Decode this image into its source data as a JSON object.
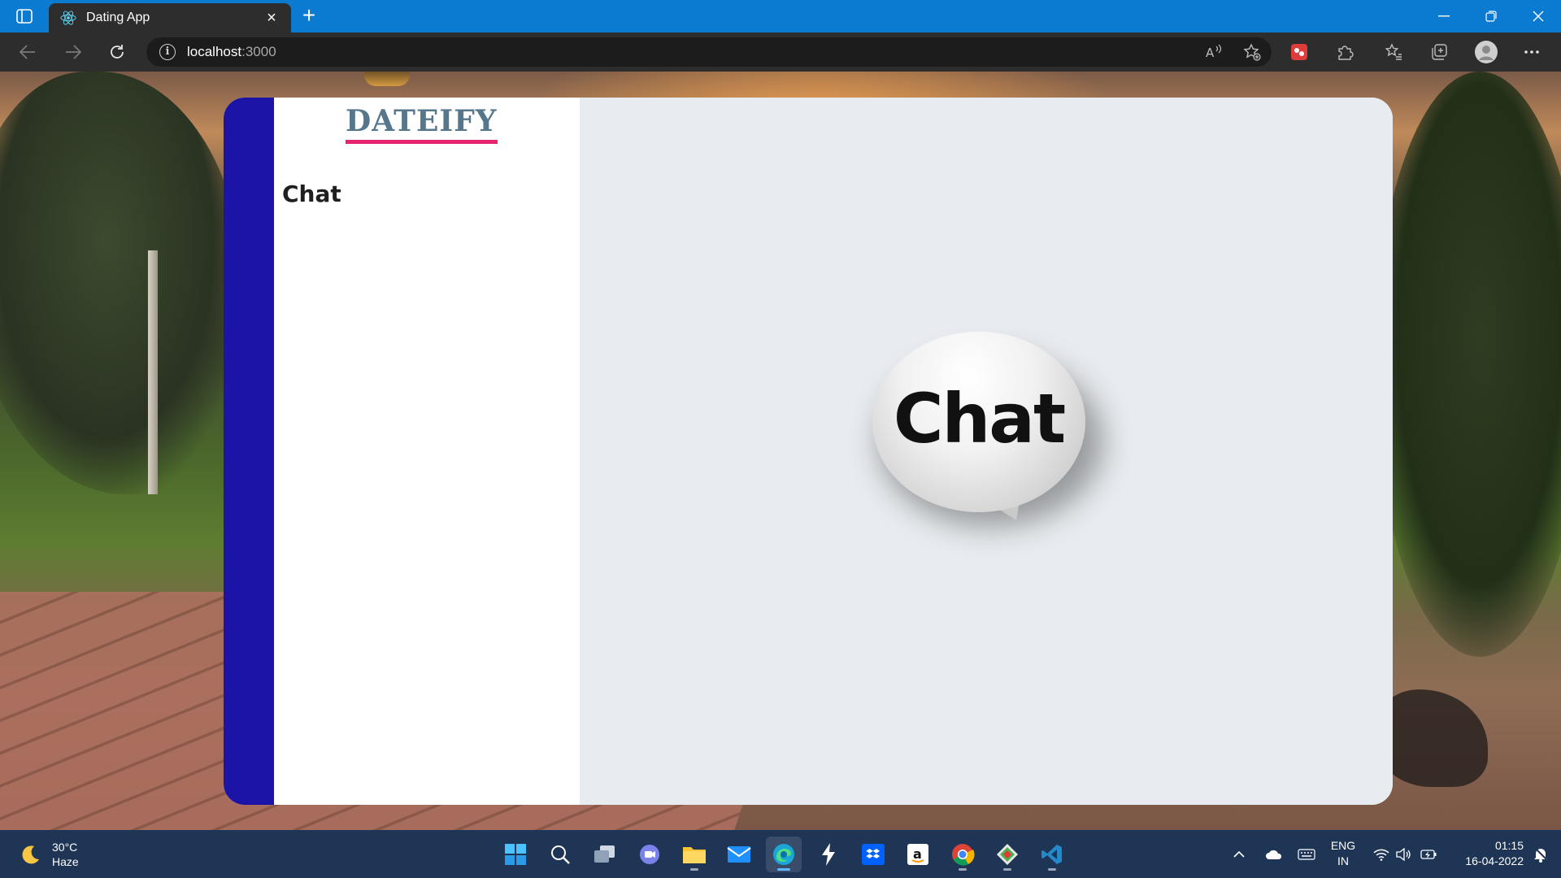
{
  "browser": {
    "tab_title": "Dating App",
    "address_host": "localhost",
    "address_port": ":3000"
  },
  "app": {
    "brand": "DATEIFY",
    "sidebar_title": "Chat",
    "placeholder_text": "Chat",
    "colors": {
      "rail": "#1b14a7",
      "brand_text": "#56768c",
      "brand_underline": "#e6236e",
      "main_bg": "#e8ecf0"
    }
  },
  "taskbar": {
    "weather_temp": "30°C",
    "weather_condition": "Haze",
    "lang_line1": "ENG",
    "lang_line2": "IN",
    "time": "01:15",
    "date": "16-04-2022",
    "apps": [
      "windows-start",
      "search",
      "task-view",
      "teams-chat",
      "file-explorer",
      "mail",
      "edge",
      "lightning-app",
      "dropbox",
      "amazon",
      "chrome",
      "git-app",
      "vscode"
    ]
  }
}
